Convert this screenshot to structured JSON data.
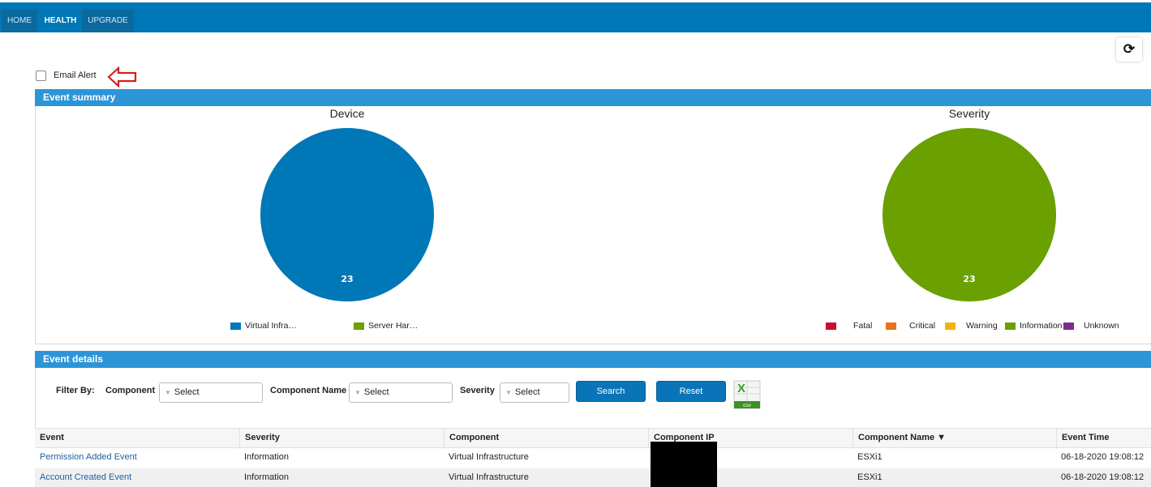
{
  "nav": {
    "tabs": [
      {
        "label": "HOME"
      },
      {
        "label": "HEALTH"
      },
      {
        "label": "UPGRADE"
      }
    ],
    "active_tab": "HEALTH"
  },
  "toolbar": {
    "refresh_icon": "refresh-icon"
  },
  "email_alert": {
    "label": "Email Alert",
    "checked": false
  },
  "event_summary": {
    "header": "Event summary",
    "device_chart": {
      "title": "Device",
      "total_label": "23",
      "legend": [
        {
          "label": "Virtual Infra…",
          "color": "#0077b6"
        },
        {
          "label": "Server Har…",
          "color": "#6aa000"
        }
      ]
    },
    "severity_chart": {
      "title": "Severity",
      "total_label": "23",
      "legend": [
        {
          "label": "Fatal",
          "color": "#c8102e"
        },
        {
          "label": "Critical",
          "color": "#e8731a"
        },
        {
          "label": "Warning",
          "color": "#f0b400"
        },
        {
          "label": "Information",
          "color": "#6aa000"
        },
        {
          "label": "Unknown",
          "color": "#7b2d8e"
        }
      ]
    }
  },
  "event_details": {
    "header": "Event details",
    "filters": {
      "filter_by_label": "Filter By:",
      "component_label": "Component",
      "component_value": "Select",
      "component_name_label": "Component Name",
      "component_name_value": "Select",
      "severity_label": "Severity",
      "severity_value": "Select",
      "search_label": "Search",
      "reset_label": "Reset",
      "csv_label": "csv",
      "csv_icon": "excel-csv-icon"
    },
    "table": {
      "columns": [
        "Event",
        "Severity",
        "Component",
        "Component IP",
        "Component Name ▼",
        "Event Time"
      ],
      "rows": [
        [
          "Permission Added Event",
          "Information",
          "Virtual Infrastructure",
          "",
          "ESXi1",
          "06-18-2020 19:08:12"
        ],
        [
          "Account Created Event",
          "Information",
          "Virtual Infrastructure",
          "",
          "ESXi1",
          "06-18-2020 19:08:12"
        ]
      ]
    }
  },
  "colors": {
    "nav": "#0077b6",
    "section": "#2c95d8",
    "device_pie": "#0077b6",
    "severity_pie": "#6aa000",
    "button": "#0a74b8"
  }
}
